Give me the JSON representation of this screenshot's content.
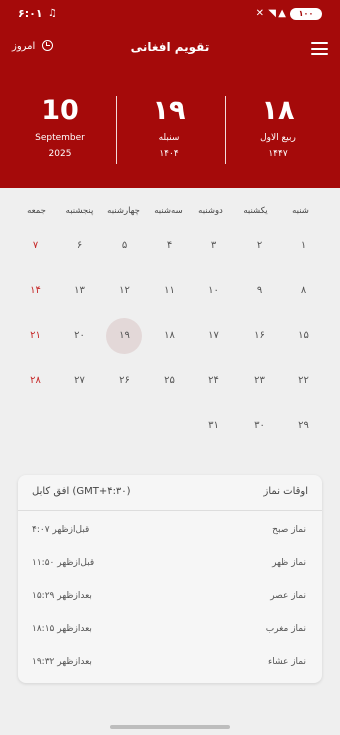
{
  "status_bar": {
    "time": "۶:۰۱",
    "battery": "۱۰۰"
  },
  "app_bar": {
    "today_label": "امروز",
    "title": "تقویم افغانی"
  },
  "dates": {
    "gregorian": {
      "day": "10",
      "month": "September",
      "year": "2025"
    },
    "solar": {
      "day": "۱۹",
      "month": "سنبله",
      "year": "۱۴۰۴"
    },
    "lunar": {
      "day": "۱۸",
      "month": "ربیع الاول",
      "year": "۱۴۴۷"
    }
  },
  "weekdays": [
    "شنبه",
    "یکشنبه",
    "دوشنبه",
    "سه‌شنبه",
    "چهارشنبه",
    "پنجشنبه",
    "جمعه"
  ],
  "calendar_days": [
    [
      "۱",
      "۲",
      "۳",
      "۴",
      "۵",
      "۶",
      "۷"
    ],
    [
      "۸",
      "۹",
      "۱۰",
      "۱۱",
      "۱۲",
      "۱۳",
      "۱۴"
    ],
    [
      "۱۵",
      "۱۶",
      "۱۷",
      "۱۸",
      "۱۹",
      "۲۰",
      "۲۱"
    ],
    [
      "۲۲",
      "۲۳",
      "۲۴",
      "۲۵",
      "۲۶",
      "۲۷",
      "۲۸"
    ],
    [
      "۲۹",
      "۳۰",
      "۳۱",
      "",
      "",
      "",
      ""
    ]
  ],
  "colors": {
    "header": "#a50a0a",
    "friday": "#c62828",
    "today_highlight": "#e3d8d8"
  },
  "prayer_card": {
    "title": "اوقات نماز",
    "timezone": "افق کابل (GMT+۴:۳۰)",
    "rows": [
      {
        "name": "نماز صبح",
        "time": "۴:۰۷ قبل‌ازظهر"
      },
      {
        "name": "نماز ظهر",
        "time": "۱۱:۵۰ قبل‌ازظهر"
      },
      {
        "name": "نماز عصر",
        "time": "۱۵:۲۹ بعدازظهر"
      },
      {
        "name": "نماز مغرب",
        "time": "۱۸:۱۵ بعدازظهر"
      },
      {
        "name": "نماز عشاء",
        "time": "۱۹:۳۲ بعدازظهر"
      }
    ]
  }
}
